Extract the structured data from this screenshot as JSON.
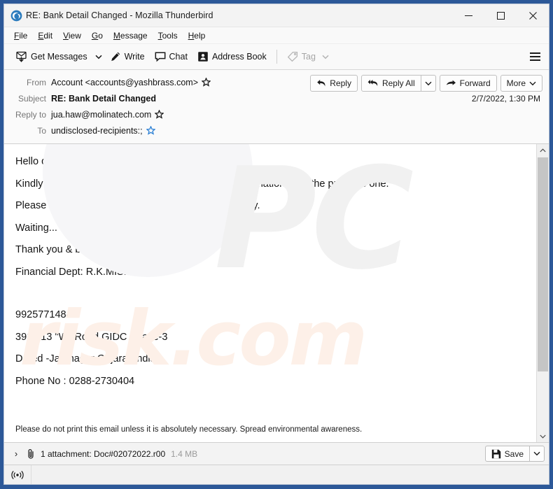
{
  "window": {
    "app_icon": "thunderbird-icon",
    "title": "RE: Bank Detail Changed - Mozilla Thunderbird",
    "minimize_label": "─",
    "maximize_label": "□",
    "close_label": "✕"
  },
  "menubar": {
    "items": [
      {
        "name": "file",
        "accel": "F",
        "rest": "ile"
      },
      {
        "name": "edit",
        "accel": "E",
        "rest": "dit"
      },
      {
        "name": "view",
        "accel": "V",
        "rest": "iew"
      },
      {
        "name": "go",
        "accel": "G",
        "rest": "o"
      },
      {
        "name": "message",
        "accel": "M",
        "rest": "essage"
      },
      {
        "name": "tools",
        "accel": "T",
        "rest": "ools"
      },
      {
        "name": "help",
        "accel": "H",
        "rest": "elp"
      }
    ]
  },
  "toolbar": {
    "get_messages_label": "Get Messages",
    "write_label": "Write",
    "chat_label": "Chat",
    "address_book_label": "Address Book",
    "tag_label": "Tag",
    "menu_label": "☰"
  },
  "header": {
    "from_label": "From",
    "from_value": "Account <accounts@yashbrass.com>",
    "subject_label": "Subject",
    "subject_value": "RE: Bank Detail Changed",
    "reply_to_label": "Reply to",
    "reply_to_value": "jua.haw@molinatech.com",
    "to_label": "To",
    "to_value": "undisclosed-recipients:;",
    "date": "2/7/2022, 1:30 PM",
    "buttons": {
      "reply": "Reply",
      "reply_all": "Reply All",
      "forward": "Forward",
      "more": "More"
    }
  },
  "message": {
    "lines": [
      "Hello dear,",
      "Kindly let us know why we receive another Bank information after the previous one.",
      "Please let us know if its from your side and tell us why.",
      "Waiting... for your immediate reply",
      "Thank you & best regards",
      "Financial Dept: R.K.MISHRA",
      "9925771484",
      "3912/13 \"W\" Road GIDC Phase-3",
      "Dared -Jamnagar Gujarat-India",
      "Phone No : 0288-2730404"
    ],
    "disclaimer": "Please do not print this email unless it is absolutely necessary. Spread environmental awareness.",
    "watermark_primary": "PC",
    "watermark_secondary": "risk.com"
  },
  "attachment": {
    "expand_label": "›",
    "text": "1 attachment: Doc#02072022.r00",
    "size": "1.4 MB",
    "save_label": "Save",
    "dropdown_label": "⌄"
  },
  "statusbar": {
    "icon": "network-signal-icon"
  },
  "colors": {
    "window_frame": "#2c5898",
    "toolbar_bg": "#f9f9f9",
    "header_bg": "#fafafa",
    "body_bg": "#ffffff",
    "star_blue": "#2a7fd4",
    "muted_text": "#767676"
  }
}
